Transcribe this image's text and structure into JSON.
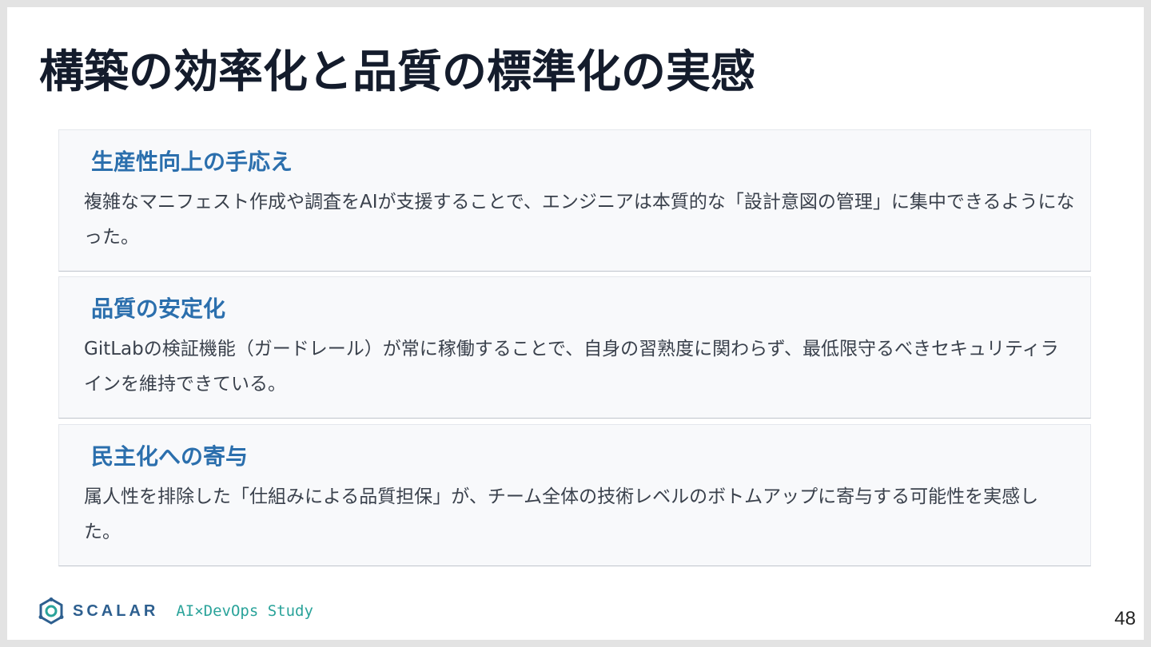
{
  "slide": {
    "title": "構築の効率化と品質の標準化の実感",
    "cards": [
      {
        "title": "生産性向上の手応え",
        "body": "複雑なマニフェスト作成や調査をAIが支援することで、エンジニアは本質的な「設計意図の管理」に集中できるようになった。"
      },
      {
        "title": "品質の安定化",
        "body": "GitLabの検証機能（ガードレール）が常に稼働することで、自身の習熟度に関わらず、最低限守るべきセキュリティラインを維持できている。"
      },
      {
        "title": "民主化への寄与",
        "body": "属人性を排除した「仕組みによる品質担保」が、チーム全体の技術レベルのボトムアップに寄与する可能性を実感した。"
      }
    ]
  },
  "footer": {
    "logo_text": "SCALAR",
    "logo_icon": "scalar-logo-icon",
    "study_label": "AI×DevOps Study",
    "page_number": "48"
  },
  "colors": {
    "title": "#141c2c",
    "card_title": "#2b6fad",
    "body_text": "#3a414c",
    "logo": "#2d5f8f",
    "study": "#2aa39a"
  }
}
